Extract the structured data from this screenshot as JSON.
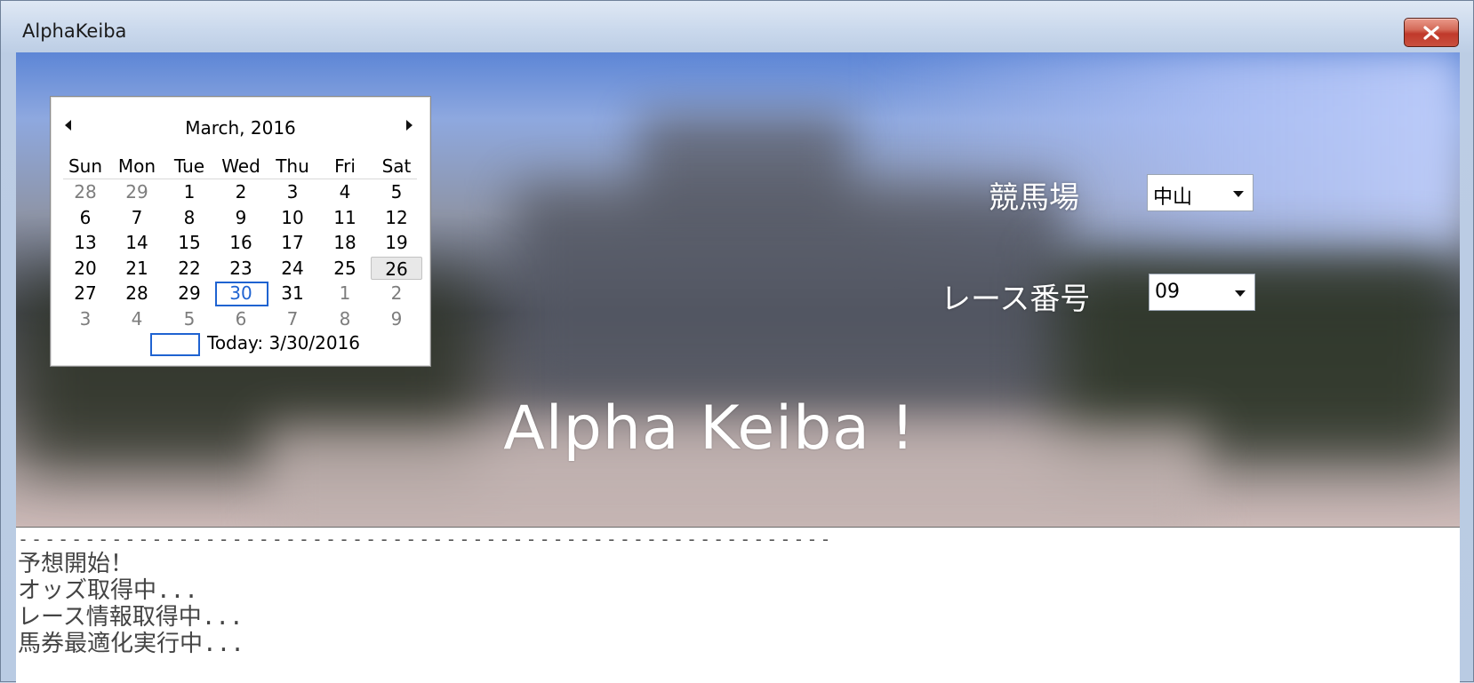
{
  "window": {
    "title": "AlphaKeiba"
  },
  "calendar": {
    "month_label": "March, 2016",
    "weekdays": [
      "Sun",
      "Mon",
      "Tue",
      "Wed",
      "Thu",
      "Fri",
      "Sat"
    ],
    "weeks": [
      [
        "28",
        "29",
        "1",
        "2",
        "3",
        "4",
        "5"
      ],
      [
        "6",
        "7",
        "8",
        "9",
        "10",
        "11",
        "12"
      ],
      [
        "13",
        "14",
        "15",
        "16",
        "17",
        "18",
        "19"
      ],
      [
        "20",
        "21",
        "22",
        "23",
        "24",
        "25",
        "26"
      ],
      [
        "27",
        "28",
        "29",
        "30",
        "31",
        "1",
        "2"
      ],
      [
        "3",
        "4",
        "5",
        "6",
        "7",
        "8",
        "9"
      ]
    ],
    "today_label": "Today: 3/30/2016"
  },
  "form": {
    "racecourse_label": "競馬場",
    "racecourse_value": "中山",
    "race_number_label": "レース番号",
    "race_number_value": "09"
  },
  "banner": {
    "title": "Alpha Keiba !"
  },
  "log": {
    "separator": "-------------------------------------------------------------",
    "lines": [
      "予想開始！",
      "オッズ取得中...",
      "レース情報取得中...",
      "馬券最適化実行中..."
    ]
  }
}
